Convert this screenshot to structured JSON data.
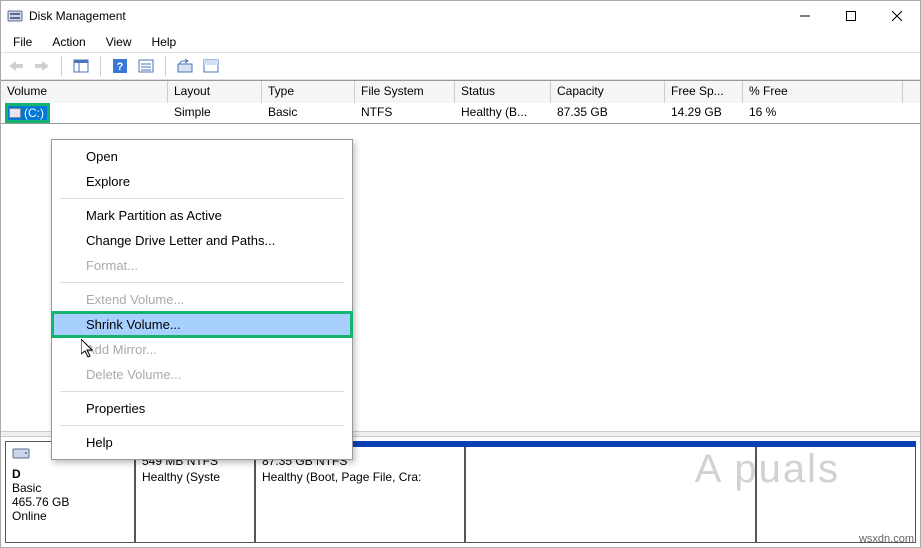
{
  "title": "Disk Management",
  "menus": {
    "file": "File",
    "action": "Action",
    "view": "View",
    "help": "Help"
  },
  "columns": {
    "volume": "Volume",
    "layout": "Layout",
    "type": "Type",
    "fs": "File System",
    "status": "Status",
    "capacity": "Capacity",
    "free": "Free Sp...",
    "pct": "% Free"
  },
  "row": {
    "volume_label": "(C:)",
    "layout": "Simple",
    "type": "Basic",
    "fs": "NTFS",
    "status": "Healthy (B...",
    "capacity": "87.35 GB",
    "free": "14.29 GB",
    "pct": "16 %"
  },
  "disk": {
    "name": "D",
    "type": "Basic",
    "size": "465.76 GB",
    "status": "Online",
    "partitions": {
      "p1_line1": "549 MB NTFS",
      "p1_line2": "Healthy (Syste",
      "p2_line1": "87.35 GB NTFS",
      "p2_line2": "Healthy (Boot, Page File, Cra:"
    }
  },
  "ctx": {
    "open": "Open",
    "explore": "Explore",
    "mark": "Mark Partition as Active",
    "change": "Change Drive Letter and Paths...",
    "format": "Format...",
    "extend": "Extend Volume...",
    "shrink": "Shrink Volume...",
    "mirror": "Add Mirror...",
    "delete": "Delete Volume...",
    "props": "Properties",
    "help": "Help"
  },
  "watermark": "A    puals",
  "attribution": "wsxdn.com"
}
